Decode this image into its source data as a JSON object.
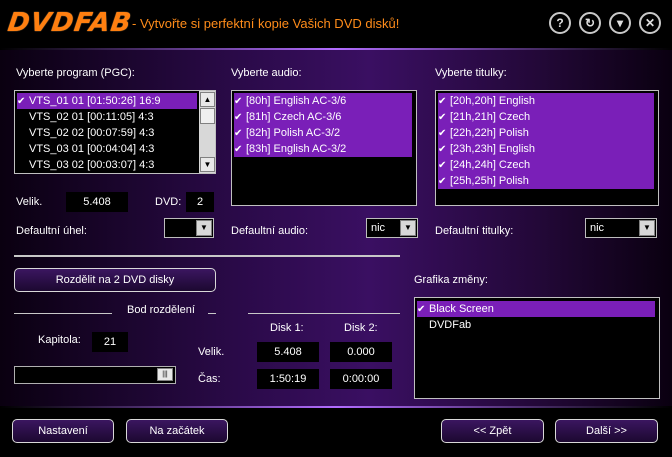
{
  "header": {
    "logo": "DVDFAB",
    "slogan": "- Vytvořte si perfektní kopie Vašich DVD disků!",
    "buttons": {
      "help": "?",
      "refresh": "↻",
      "minimize": "▾",
      "close": "✕"
    }
  },
  "program": {
    "label": "Vyberte program (PGC):",
    "items": [
      "VTS_01 01 [01:50:26] 16:9",
      "VTS_02 01 [00:11:05] 4:3",
      "VTS_02 02 [00:07:59] 4:3",
      "VTS_03 01 [00:04:04] 4:3",
      "VTS_03 02 [00:03:07] 4:3"
    ],
    "size_label": "Velik.",
    "size_value": "5.408",
    "dvd_label": "DVD:",
    "dvd_value": "2",
    "angle_label": "Defaultní úhel:",
    "angle_value": ""
  },
  "audio": {
    "label": "Vyberte audio:",
    "items": [
      "[80h] English AC-3/6",
      "[81h] Czech AC-3/6",
      "[82h] Polish AC-3/2",
      "[83h] English AC-3/2"
    ],
    "default_label": "Defaultní audio:",
    "default_value": "nic"
  },
  "subtitles": {
    "label": "Vyberte titulky:",
    "items": [
      "[20h,20h] English",
      "[21h,21h] Czech",
      "[22h,22h] Polish",
      "[23h,23h] English",
      "[24h,24h] Czech",
      "[25h,25h] Polish"
    ],
    "default_label": "Defaultní titulky:",
    "default_value": "nic"
  },
  "split": {
    "button": "Rozdělit na 2 DVD disky",
    "point_label": "Bod rozdělení",
    "chapter_label": "Kapitola:",
    "chapter_value": "21",
    "disk1_label": "Disk 1:",
    "disk2_label": "Disk 2:",
    "size_label": "Velik.",
    "size1": "5.408",
    "size2": "0.000",
    "time_label": "Čas:",
    "time1": "1:50:19",
    "time2": "0:00:00",
    "slider_position": 1.0
  },
  "transitions": {
    "label": "Grafika změny:",
    "items": [
      "Black Screen",
      "DVDFab"
    ]
  },
  "footer": {
    "settings": "Nastavení",
    "start": "Na začátek",
    "back": "<< Zpět",
    "next": "Další >>"
  },
  "colors": {
    "selection": "#7a1fb8",
    "accent": "#ff8c1a"
  }
}
